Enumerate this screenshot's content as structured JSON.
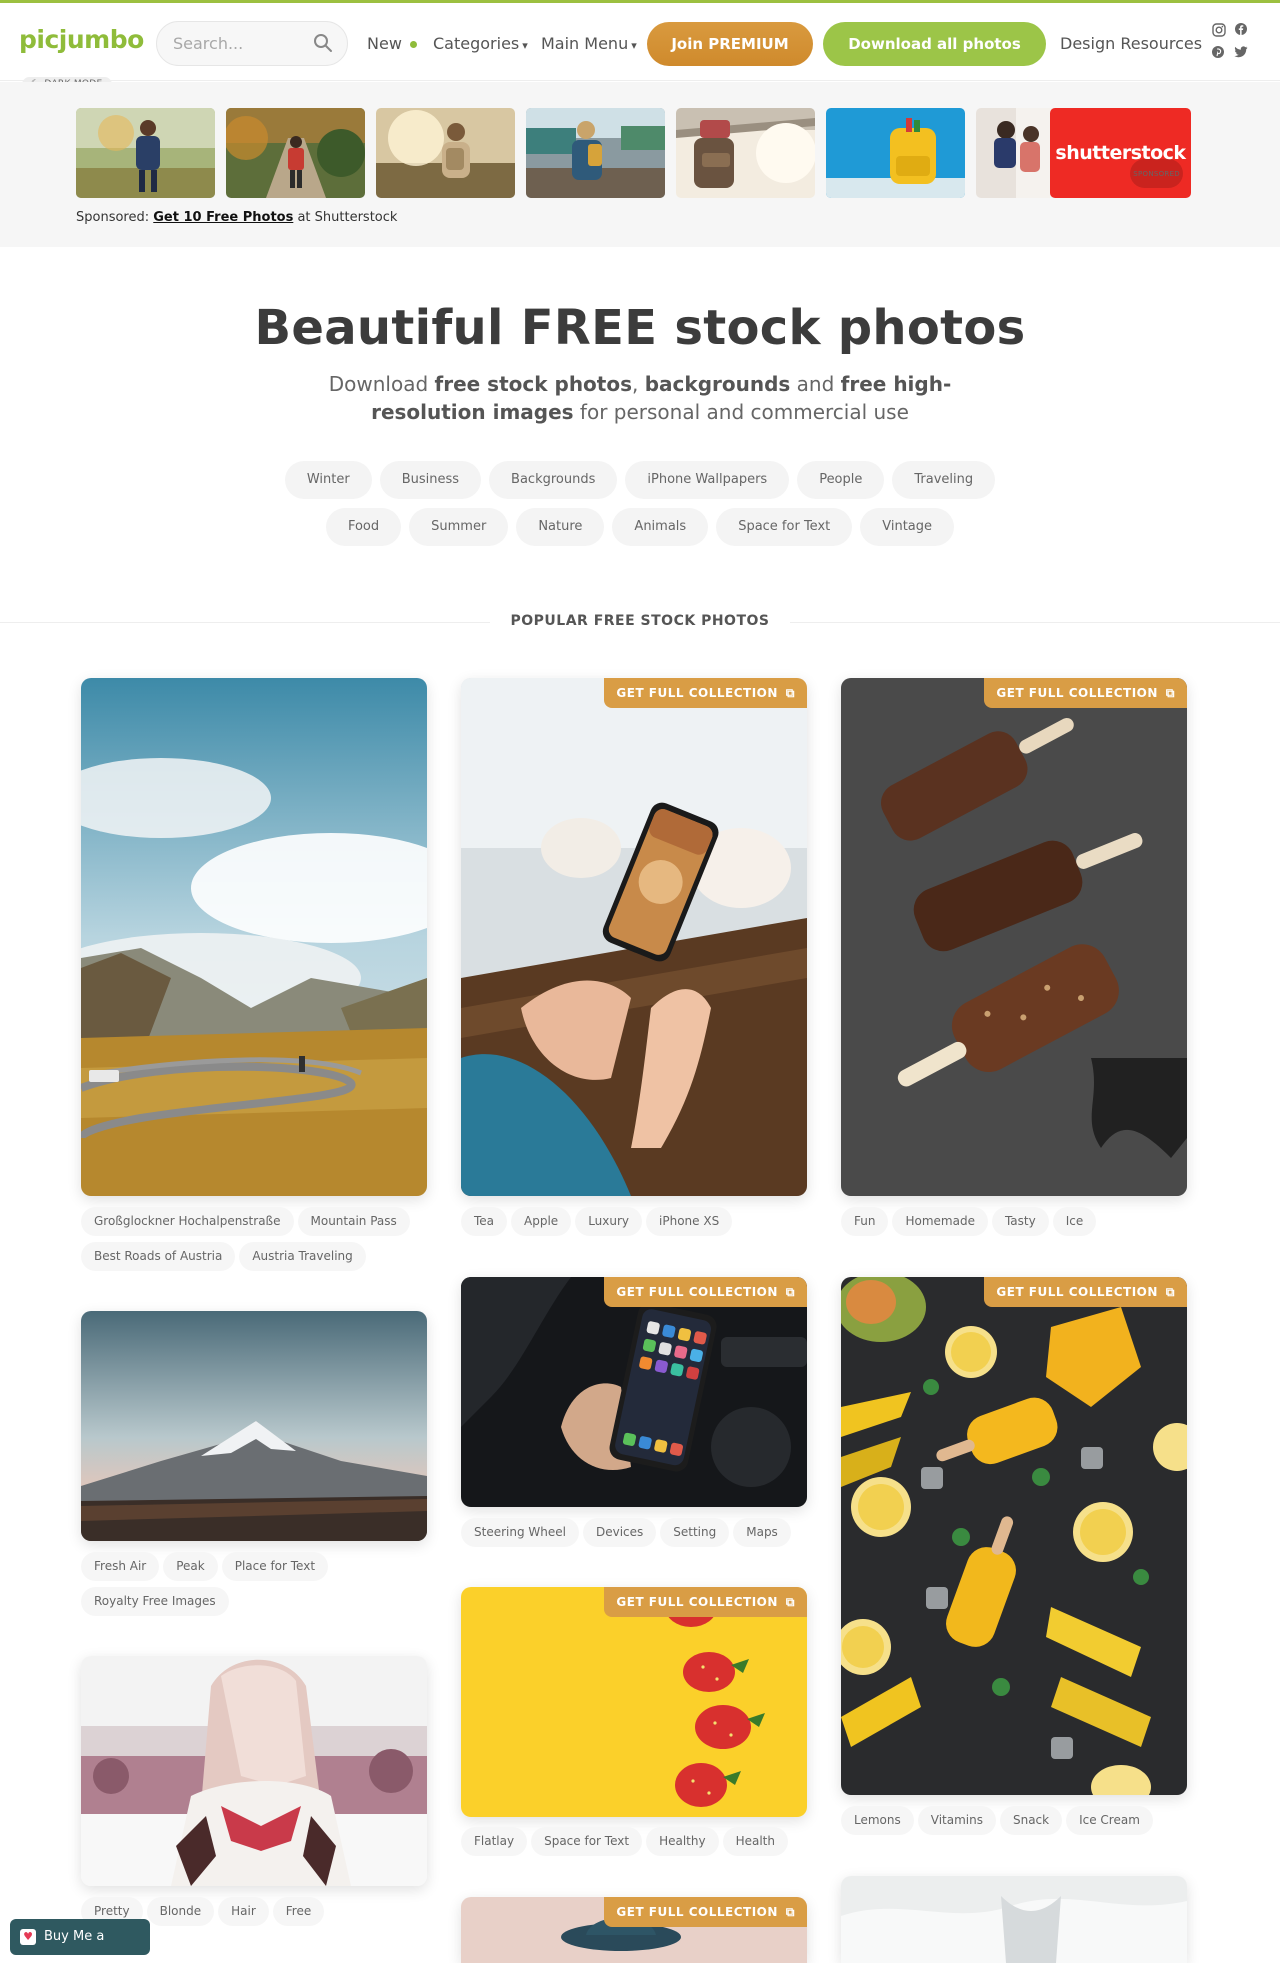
{
  "header": {
    "logo": "picjumbo",
    "search_placeholder": "Search...",
    "nav": {
      "new_label": "New",
      "categories_label": "Categories",
      "main_menu_label": "Main Menu",
      "design_resources_label": "Design Resources"
    },
    "join_premium_label": "Join PREMIUM",
    "download_all_label": "Download all photos",
    "dark_mode_label": "DARK MODE",
    "social_icons": [
      "instagram-icon",
      "facebook-icon",
      "pinterest-icon",
      "twitter-icon"
    ],
    "accent_color": "#8fbc3a"
  },
  "sponsored": {
    "thumbnails": [
      "girl-backpack-field",
      "hiker-forest-trail",
      "woman-mountain-sunset",
      "backpacker-street-market",
      "backpack-bridge-sunset",
      "yellow-backpack-blue-wall",
      "kids-school-backpacks"
    ],
    "shutterstock_label": "shutterstock",
    "sponsored_tag": "SPONSORED",
    "line_prefix": "Sponsored:",
    "line_link": "Get 10 Free Photos",
    "line_suffix": "at Shutterstock"
  },
  "hero": {
    "title": "Beautiful FREE stock photos",
    "sub_1": "Download ",
    "sub_2": "free stock photos",
    "sub_3": ", ",
    "sub_4": "backgrounds",
    "sub_5": " and ",
    "sub_6": "free high-resolution images",
    "sub_7": " for personal and commercial use"
  },
  "categories_row1": [
    "Winter",
    "Business",
    "Backgrounds",
    "iPhone Wallpapers",
    "People",
    "Traveling"
  ],
  "categories_row2": [
    "Food",
    "Summer",
    "Nature",
    "Animals",
    "Space for Text",
    "Vintage"
  ],
  "section_title": "POPULAR FREE STOCK PHOTOS",
  "badge_label": "GET FULL COLLECTION",
  "cards": [
    {
      "name": "mountain-road-austria",
      "tags": [
        "Großglockner Hochalpenstraße",
        "Mountain Pass",
        "Best Roads of Austria",
        "Austria Traveling"
      ]
    },
    {
      "name": "iphone-in-hands-cafe",
      "tags": [
        "Tea",
        "Apple",
        "Luxury",
        "iPhone XS"
      ]
    },
    {
      "name": "chocolate-ice-cream",
      "tags": [
        "Fun",
        "Homemade",
        "Tasty",
        "Ice"
      ]
    },
    {
      "name": "mountain-peak-dusk",
      "tags": [
        "Fresh Air",
        "Peak",
        "Place for Text",
        "Royalty Free Images"
      ]
    },
    {
      "name": "iphone-car-interior",
      "tags": [
        "Steering Wheel",
        "Devices",
        "Setting",
        "Maps"
      ]
    },
    {
      "name": "mango-popsicles-lemons",
      "tags": [
        "Lemons",
        "Vitamins",
        "Snack",
        "Ice Cream"
      ]
    },
    {
      "name": "blonde-woman-hair",
      "tags": [
        "Pretty",
        "Blonde",
        "Hair",
        "Free"
      ]
    },
    {
      "name": "strawberries-yellow",
      "tags": [
        "Flatlay",
        "Space for Text",
        "Healthy",
        "Health"
      ]
    }
  ],
  "coffee_label": "Buy Me a Coffee"
}
